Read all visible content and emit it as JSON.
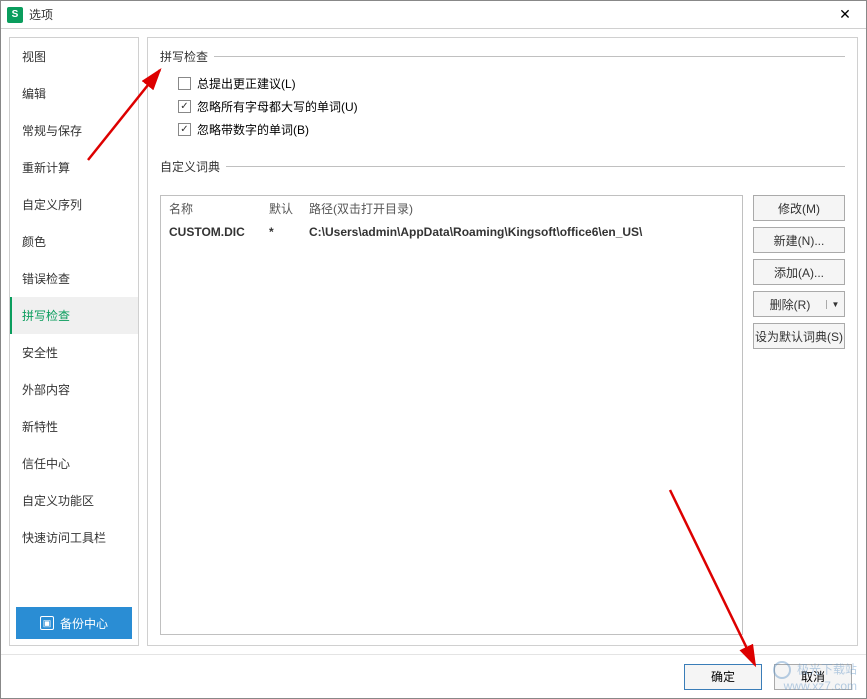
{
  "titlebar": {
    "app_icon_letter": "S",
    "title": "选项"
  },
  "sidebar": {
    "items": [
      {
        "label": "视图"
      },
      {
        "label": "编辑"
      },
      {
        "label": "常规与保存"
      },
      {
        "label": "重新计算"
      },
      {
        "label": "自定义序列"
      },
      {
        "label": "颜色"
      },
      {
        "label": "错误检查"
      },
      {
        "label": "拼写检查"
      },
      {
        "label": "安全性"
      },
      {
        "label": "外部内容"
      },
      {
        "label": "新特性"
      },
      {
        "label": "信任中心"
      },
      {
        "label": "自定义功能区"
      },
      {
        "label": "快速访问工具栏"
      }
    ],
    "active_index": 7,
    "backup_label": "备份中心"
  },
  "main": {
    "spellcheck_group": "拼写检查",
    "checkboxes": [
      {
        "label": "总提出更正建议(L)",
        "checked": false
      },
      {
        "label": "忽略所有字母都大写的单词(U)",
        "checked": true
      },
      {
        "label": "忽略带数字的单词(B)",
        "checked": true
      }
    ],
    "dict_group": "自定义词典",
    "dict_table": {
      "headers": {
        "name": "名称",
        "default": "默认",
        "path": "路径(双击打开目录)"
      },
      "rows": [
        {
          "name": "CUSTOM.DIC",
          "default": "*",
          "path": "C:\\Users\\admin\\AppData\\Roaming\\Kingsoft\\office6\\en_US\\"
        }
      ]
    },
    "dict_buttons": {
      "modify": "修改(M)",
      "new": "新建(N)...",
      "add": "添加(A)...",
      "delete": "删除(R)",
      "set_default": "设为默认词典(S)"
    }
  },
  "footer": {
    "ok": "确定",
    "cancel": "取消"
  },
  "watermark": {
    "line1": "极光下载站",
    "line2": "www.xz7.com"
  }
}
